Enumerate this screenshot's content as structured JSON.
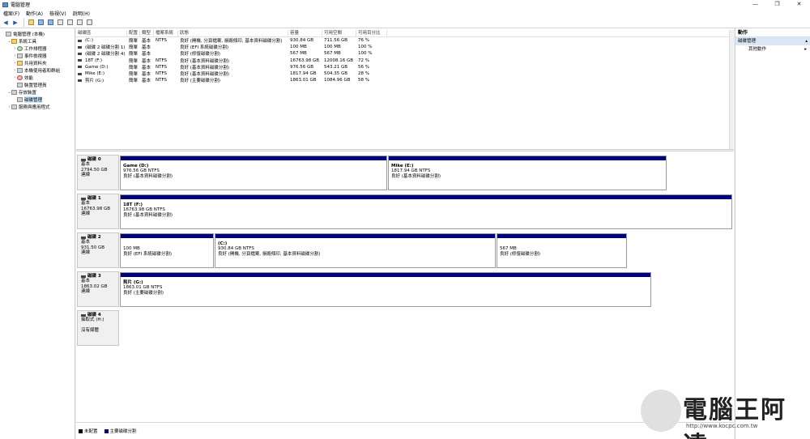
{
  "window": {
    "title": "電腦管理",
    "controls": [
      "—",
      "❐",
      "✕"
    ]
  },
  "menu": [
    "檔案(F)",
    "動作(A)",
    "檢視(V)",
    "說明(H)"
  ],
  "tree": [
    {
      "label": "電腦管理 (本機)",
      "indent": 0,
      "caret": "",
      "icon": "g"
    },
    {
      "label": "系統工具",
      "indent": 1,
      "caret": "⌄",
      "icon": "y"
    },
    {
      "label": "工作排程器",
      "indent": 2,
      "caret": "›",
      "icon": "c"
    },
    {
      "label": "事件檢視器",
      "indent": 2,
      "caret": "›",
      "icon": "g"
    },
    {
      "label": "共用資料夾",
      "indent": 2,
      "caret": "›",
      "icon": "y"
    },
    {
      "label": "本機使用者和群組",
      "indent": 2,
      "caret": "›",
      "icon": "g"
    },
    {
      "label": "效能",
      "indent": 2,
      "caret": "›",
      "icon": "r"
    },
    {
      "label": "裝置管理員",
      "indent": 2,
      "caret": "",
      "icon": "g"
    },
    {
      "label": "存放裝置",
      "indent": 1,
      "caret": "⌄",
      "icon": "g"
    },
    {
      "label": "磁碟管理",
      "indent": 2,
      "caret": "",
      "icon": "g",
      "selected": true
    },
    {
      "label": "服務與應用程式",
      "indent": 1,
      "caret": "›",
      "icon": "g"
    }
  ],
  "volume_table": {
    "headers": [
      "磁碟區",
      "配置",
      "類型",
      "檔案系統",
      "狀態",
      "容量",
      "可用空間",
      "可用百分比"
    ],
    "rows": [
      [
        "(C:)",
        "簡單",
        "基本",
        "NTFS",
        "良好 (開機, 分頁檔案, 損毀傾印, 基本資料磁碟分割)",
        "930.84 GB",
        "711.56 GB",
        "76 %"
      ],
      [
        "(磁碟 2 磁碟分割 1)",
        "簡單",
        "基本",
        "",
        "良好 (EFI 系統磁碟分割)",
        "100 MB",
        "100 MB",
        "100 %"
      ],
      [
        "(磁碟 2 磁碟分割 4)",
        "簡單",
        "基本",
        "",
        "良好 (修復磁碟分割)",
        "567 MB",
        "567 MB",
        "100 %"
      ],
      [
        "18T (F:)",
        "簡單",
        "基本",
        "NTFS",
        "良好 (基本資料磁碟分割)",
        "16763.98 GB",
        "12008.16 GB",
        "72 %"
      ],
      [
        "Game (D:)",
        "簡單",
        "基本",
        "NTFS",
        "良好 (基本資料磁碟分割)",
        "976.56 GB",
        "543.21 GB",
        "56 %"
      ],
      [
        "Mike (E:)",
        "簡單",
        "基本",
        "NTFS",
        "良好 (基本資料磁碟分割)",
        "1817.94 GB",
        "504.35 GB",
        "28 %"
      ],
      [
        "剪片 (G:)",
        "簡單",
        "基本",
        "NTFS",
        "良好 (主要磁碟分割)",
        "1863.01 GB",
        "1084.96 GB",
        "58 %"
      ]
    ]
  },
  "disks": [
    {
      "name": "磁碟 0",
      "type": "基本",
      "size": "2794.50 GB",
      "status": "連線",
      "parts": [
        {
          "name": "Game  (D:)",
          "size": "976.56 GB NTFS",
          "status": "良好 (基本資料磁碟分割)"
        },
        {
          "name": "Mike  (E:)",
          "size": "1817.94 GB NTFS",
          "status": "良好 (基本資料磁碟分割)"
        }
      ]
    },
    {
      "name": "磁碟 1",
      "type": "基本",
      "size": "16763.98 GB",
      "status": "連線",
      "parts": [
        {
          "name": "18T  (F:)",
          "size": "16763.98 GB NTFS",
          "status": "良好 (基本資料磁碟分割)"
        }
      ]
    },
    {
      "name": "磁碟 2",
      "type": "基本",
      "size": "931.50 GB",
      "status": "連線",
      "parts": [
        {
          "name": "",
          "size": "100 MB",
          "status": "良好 (EFI 系統磁碟分割)"
        },
        {
          "name": "(C:)",
          "size": "930.84 GB NTFS",
          "status": "良好 (開機, 分頁檔案, 損毀傾印, 基本資料磁碟分割)"
        },
        {
          "name": "",
          "size": "567 MB",
          "status": "良好 (修復磁碟分割)"
        }
      ]
    },
    {
      "name": "磁碟 3",
      "type": "基本",
      "size": "1863.02 GB",
      "status": "連線",
      "parts": [
        {
          "name": "剪片  (G:)",
          "size": "1863.01 GB NTFS",
          "status": "良好 (主要磁碟分割)"
        }
      ]
    },
    {
      "name": "磁碟 4",
      "type": "抽取式 (H:)",
      "size": "",
      "status": "沒有媒體",
      "parts": []
    }
  ],
  "legend": {
    "unallocated": "未配置",
    "primary": "主要磁碟分割"
  },
  "actions": {
    "header": "動作",
    "section": "磁碟管理",
    "more": "其他動作"
  },
  "watermark": {
    "text": "電腦王阿達",
    "url": "http://www.kocpc.com.tw"
  },
  "colors": {
    "partition_bar": "#00007b",
    "selection": "#cce8ff"
  }
}
